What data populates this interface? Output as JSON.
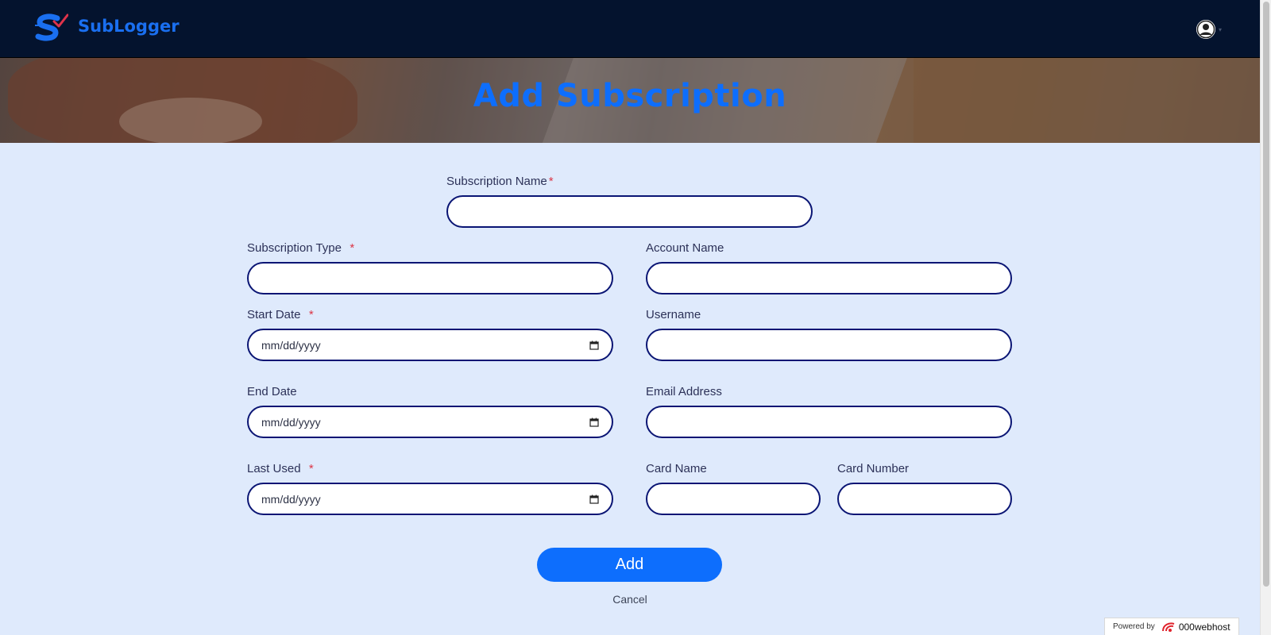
{
  "header": {
    "brand": "SubLogger",
    "logo_icon": "sublogger-s-logo-icon",
    "user_icon": "user-circle-icon"
  },
  "hero": {
    "title": "Add Subscription"
  },
  "form": {
    "subscription_name": {
      "label": "Subscription Name",
      "required": "*",
      "value": ""
    },
    "subscription_type": {
      "label": "Subscription Type",
      "required": "*",
      "value": ""
    },
    "account_name": {
      "label": "Account Name",
      "value": ""
    },
    "start_date": {
      "label": "Start Date",
      "required": "*",
      "placeholder": "mm/dd/yyyy"
    },
    "username": {
      "label": "Username",
      "value": ""
    },
    "end_date": {
      "label": "End Date",
      "placeholder": "mm/dd/yyyy"
    },
    "email_address": {
      "label": "Email Address",
      "value": ""
    },
    "last_used": {
      "label": "Last Used",
      "required": "*",
      "placeholder": "mm/dd/yyyy"
    },
    "card_name": {
      "label": "Card Name",
      "value": ""
    },
    "card_number": {
      "label": "Card Number",
      "value": ""
    },
    "add_label": "Add",
    "cancel_label": "Cancel"
  },
  "footer_badge": {
    "powered_by": "Powered by",
    "host": "000webhost"
  },
  "colors": {
    "navbar": "#04132e",
    "accent": "#0d6efd",
    "page_bg": "#dfeafc",
    "input_border": "#0a1574",
    "required": "#dc3545"
  }
}
